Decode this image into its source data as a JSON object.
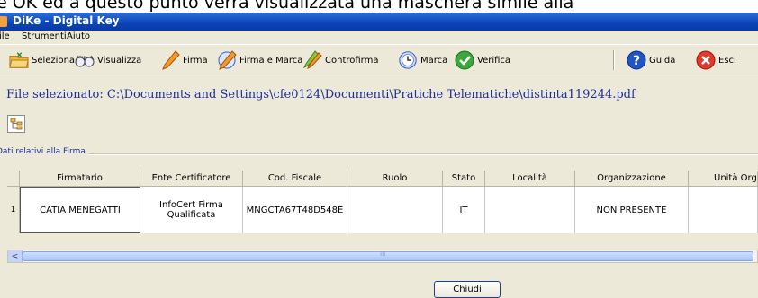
{
  "caption": "e OK ed a questo punto verrà visualizzata una maschera simile alla",
  "window": {
    "title": "DiKe - Digital Key"
  },
  "menu": [
    "ile",
    "Strumenti",
    "Aiuto"
  ],
  "toolbar": {
    "select_file": "Seleziona file",
    "view": "Visualizza",
    "sign": "Firma",
    "sign_and_stamp": "Firma e Marca",
    "countersign": "Controfirma",
    "stamp": "Marca",
    "verify": "Verifica",
    "guide": "Guida",
    "exit": "Esci"
  },
  "file_selected": "File selezionato: C:\\Documents and Settings\\cfe0124\\Documenti\\Pratiche Telematiche\\distinta119244.pdf",
  "section_label": "Dati relativi alla Firma",
  "table": {
    "columns": [
      "Firmatario",
      "Ente Certificatore",
      "Cod. Fiscale",
      "Ruolo",
      "Stato",
      "Località",
      "Organizzazione",
      "Unità Org"
    ],
    "rows": [
      {
        "num": "1",
        "cells": [
          "CATIA MENEGATTI",
          "InfoCert Firma Qualificata",
          "MNGCTA67T48D548E",
          "",
          "IT",
          "",
          "NON PRESENTE",
          ""
        ]
      }
    ]
  },
  "scrollbar": {
    "left_arrow": "<",
    "grip": "III"
  },
  "close_button": "Chiudi",
  "colors": {
    "titlebar": "#0a44b8",
    "link_text": "#1c2d9a",
    "window_bg": "#ece9d8"
  }
}
